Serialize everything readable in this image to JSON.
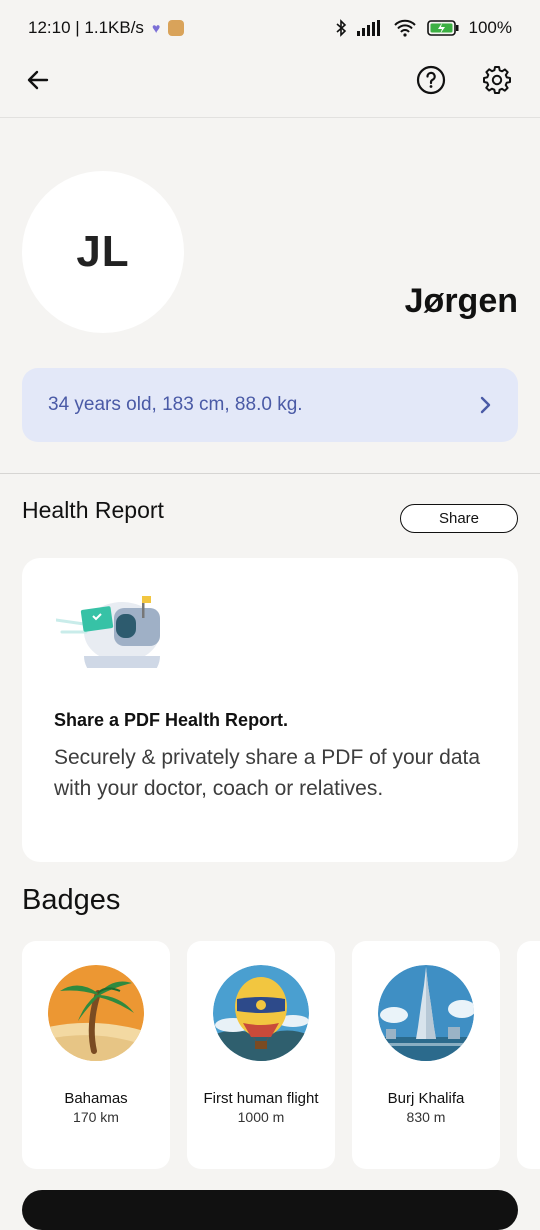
{
  "status": {
    "time_speed": "12:10 | 1.1KB/s",
    "battery": "100%",
    "icons": [
      "heart-icon",
      "app-icon",
      "bluetooth-icon",
      "signal-icon",
      "wifi-icon",
      "battery-icon"
    ]
  },
  "topbar": {
    "icons": [
      "arrow-left-icon",
      "help-circle-icon",
      "gear-icon"
    ]
  },
  "profile": {
    "initials": "JL",
    "name": "Jørgen",
    "stats": "34 years old, 183 cm, 88.0 kg."
  },
  "health_report": {
    "title": "Health Report",
    "share_label": "Share",
    "card_title": "Share a PDF Health Report.",
    "card_desc": "Securely & privately share a PDF of your data with your doctor, coach or relatives."
  },
  "badges": {
    "title": "Badges",
    "items": [
      {
        "name": "Bahamas",
        "value": "170 km"
      },
      {
        "name": "First human flight",
        "value": "1000 m"
      },
      {
        "name": "Burj Khalifa",
        "value": "830 m"
      }
    ]
  },
  "colors": {
    "background": "#f5f4f2",
    "stats_pill": "#e3e8f8",
    "stats_text": "#4a5aa6"
  }
}
